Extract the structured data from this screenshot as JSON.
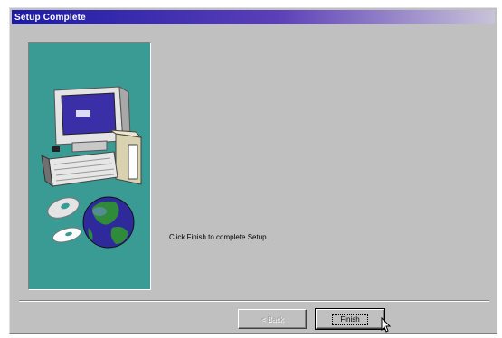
{
  "window": {
    "title": "Setup Complete"
  },
  "main": {
    "message": "Click Finish to complete Setup."
  },
  "buttons": {
    "back_label": "< Back",
    "finish_label": "Finish"
  },
  "icons": {
    "illustration": "computer-with-globe-and-disks",
    "cursor": "mouse-pointer-icon"
  },
  "colors": {
    "titlebar_start": "#1c1ba5",
    "titlebar_end": "#c9c3d8",
    "panel_teal": "#3a9a94",
    "dialog_gray": "#c0c0c0"
  }
}
